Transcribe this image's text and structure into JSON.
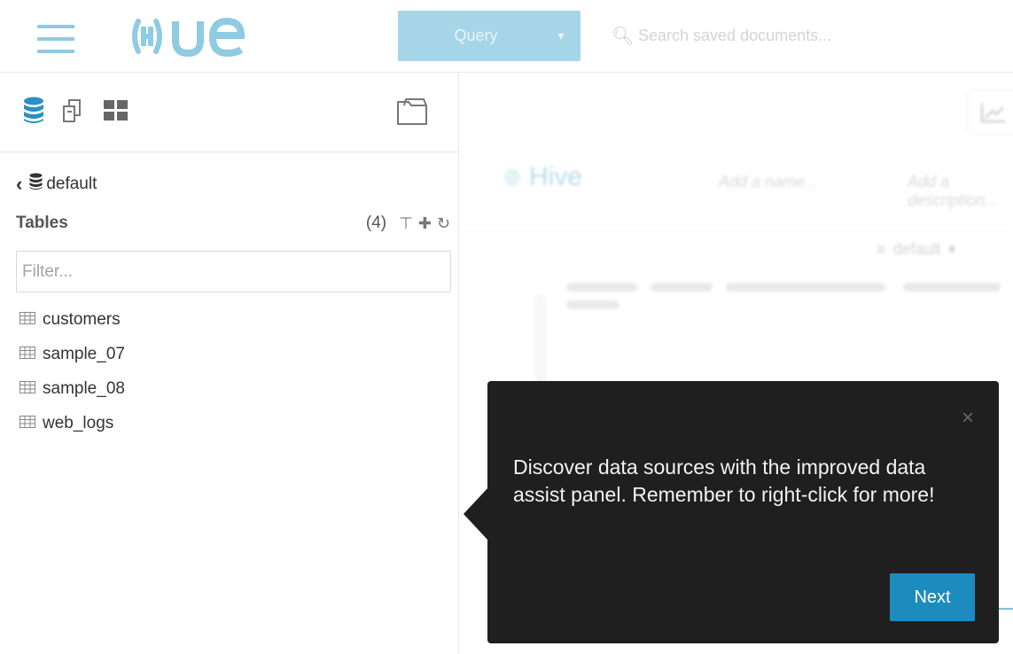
{
  "header": {
    "logo_text": "HUE",
    "query_label": "Query",
    "search_placeholder": "Search saved documents..."
  },
  "assist": {
    "icons": [
      "database-icon",
      "documents-icon",
      "apps-grid-icon",
      "folder-icon"
    ],
    "database_name": "default",
    "tables_title": "Tables",
    "tables_count": "(4)",
    "filter_placeholder": "Filter...",
    "tables": [
      {
        "name": "customers"
      },
      {
        "name": "sample_07"
      },
      {
        "name": "sample_08"
      },
      {
        "name": "web_logs"
      }
    ]
  },
  "editor": {
    "title": "Hive",
    "add_name": "Add a name...",
    "add_description": "Add a description...",
    "database": "default"
  },
  "popover": {
    "message": "Discover data sources with the improved data assist panel. Remember to right-click for more!",
    "close_glyph": "×",
    "next_label": "Next"
  },
  "colors": {
    "accent": "#1c8bbd",
    "logo": "#8fcbe3",
    "popover_bg": "#1f1f1f"
  }
}
